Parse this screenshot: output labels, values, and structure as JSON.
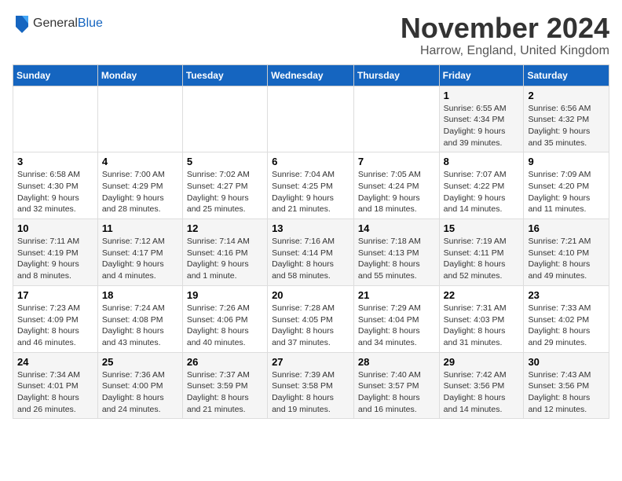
{
  "logo": {
    "general": "General",
    "blue": "Blue"
  },
  "title": "November 2024",
  "location": "Harrow, England, United Kingdom",
  "days_of_week": [
    "Sunday",
    "Monday",
    "Tuesday",
    "Wednesday",
    "Thursday",
    "Friday",
    "Saturday"
  ],
  "weeks": [
    [
      {
        "day": "",
        "info": ""
      },
      {
        "day": "",
        "info": ""
      },
      {
        "day": "",
        "info": ""
      },
      {
        "day": "",
        "info": ""
      },
      {
        "day": "",
        "info": ""
      },
      {
        "day": "1",
        "info": "Sunrise: 6:55 AM\nSunset: 4:34 PM\nDaylight: 9 hours and 39 minutes."
      },
      {
        "day": "2",
        "info": "Sunrise: 6:56 AM\nSunset: 4:32 PM\nDaylight: 9 hours and 35 minutes."
      }
    ],
    [
      {
        "day": "3",
        "info": "Sunrise: 6:58 AM\nSunset: 4:30 PM\nDaylight: 9 hours and 32 minutes."
      },
      {
        "day": "4",
        "info": "Sunrise: 7:00 AM\nSunset: 4:29 PM\nDaylight: 9 hours and 28 minutes."
      },
      {
        "day": "5",
        "info": "Sunrise: 7:02 AM\nSunset: 4:27 PM\nDaylight: 9 hours and 25 minutes."
      },
      {
        "day": "6",
        "info": "Sunrise: 7:04 AM\nSunset: 4:25 PM\nDaylight: 9 hours and 21 minutes."
      },
      {
        "day": "7",
        "info": "Sunrise: 7:05 AM\nSunset: 4:24 PM\nDaylight: 9 hours and 18 minutes."
      },
      {
        "day": "8",
        "info": "Sunrise: 7:07 AM\nSunset: 4:22 PM\nDaylight: 9 hours and 14 minutes."
      },
      {
        "day": "9",
        "info": "Sunrise: 7:09 AM\nSunset: 4:20 PM\nDaylight: 9 hours and 11 minutes."
      }
    ],
    [
      {
        "day": "10",
        "info": "Sunrise: 7:11 AM\nSunset: 4:19 PM\nDaylight: 9 hours and 8 minutes."
      },
      {
        "day": "11",
        "info": "Sunrise: 7:12 AM\nSunset: 4:17 PM\nDaylight: 9 hours and 4 minutes."
      },
      {
        "day": "12",
        "info": "Sunrise: 7:14 AM\nSunset: 4:16 PM\nDaylight: 9 hours and 1 minute."
      },
      {
        "day": "13",
        "info": "Sunrise: 7:16 AM\nSunset: 4:14 PM\nDaylight: 8 hours and 58 minutes."
      },
      {
        "day": "14",
        "info": "Sunrise: 7:18 AM\nSunset: 4:13 PM\nDaylight: 8 hours and 55 minutes."
      },
      {
        "day": "15",
        "info": "Sunrise: 7:19 AM\nSunset: 4:11 PM\nDaylight: 8 hours and 52 minutes."
      },
      {
        "day": "16",
        "info": "Sunrise: 7:21 AM\nSunset: 4:10 PM\nDaylight: 8 hours and 49 minutes."
      }
    ],
    [
      {
        "day": "17",
        "info": "Sunrise: 7:23 AM\nSunset: 4:09 PM\nDaylight: 8 hours and 46 minutes."
      },
      {
        "day": "18",
        "info": "Sunrise: 7:24 AM\nSunset: 4:08 PM\nDaylight: 8 hours and 43 minutes."
      },
      {
        "day": "19",
        "info": "Sunrise: 7:26 AM\nSunset: 4:06 PM\nDaylight: 8 hours and 40 minutes."
      },
      {
        "day": "20",
        "info": "Sunrise: 7:28 AM\nSunset: 4:05 PM\nDaylight: 8 hours and 37 minutes."
      },
      {
        "day": "21",
        "info": "Sunrise: 7:29 AM\nSunset: 4:04 PM\nDaylight: 8 hours and 34 minutes."
      },
      {
        "day": "22",
        "info": "Sunrise: 7:31 AM\nSunset: 4:03 PM\nDaylight: 8 hours and 31 minutes."
      },
      {
        "day": "23",
        "info": "Sunrise: 7:33 AM\nSunset: 4:02 PM\nDaylight: 8 hours and 29 minutes."
      }
    ],
    [
      {
        "day": "24",
        "info": "Sunrise: 7:34 AM\nSunset: 4:01 PM\nDaylight: 8 hours and 26 minutes."
      },
      {
        "day": "25",
        "info": "Sunrise: 7:36 AM\nSunset: 4:00 PM\nDaylight: 8 hours and 24 minutes."
      },
      {
        "day": "26",
        "info": "Sunrise: 7:37 AM\nSunset: 3:59 PM\nDaylight: 8 hours and 21 minutes."
      },
      {
        "day": "27",
        "info": "Sunrise: 7:39 AM\nSunset: 3:58 PM\nDaylight: 8 hours and 19 minutes."
      },
      {
        "day": "28",
        "info": "Sunrise: 7:40 AM\nSunset: 3:57 PM\nDaylight: 8 hours and 16 minutes."
      },
      {
        "day": "29",
        "info": "Sunrise: 7:42 AM\nSunset: 3:56 PM\nDaylight: 8 hours and 14 minutes."
      },
      {
        "day": "30",
        "info": "Sunrise: 7:43 AM\nSunset: 3:56 PM\nDaylight: 8 hours and 12 minutes."
      }
    ]
  ]
}
